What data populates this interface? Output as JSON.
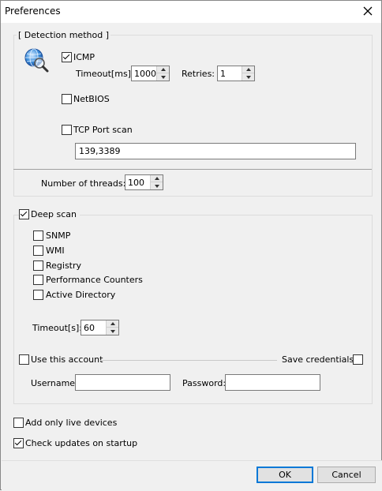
{
  "window": {
    "title": "Preferences"
  },
  "detection": {
    "legend": "[ Detection method ]",
    "icmp": {
      "label": "ICMP",
      "checked": true
    },
    "timeout_label": "Timeout[ms]:",
    "timeout_value": "1000",
    "retries_label": "Retries:",
    "retries_value": "1",
    "netbios": {
      "label": "NetBIOS",
      "checked": false
    },
    "tcp": {
      "label": "TCP Port scan",
      "checked": false
    },
    "ports_value": "139,3389"
  },
  "threads": {
    "label": "Number of threads:",
    "value": "100"
  },
  "deep_scan": {
    "label": "Deep scan",
    "checked": true,
    "items": [
      {
        "label": "SNMP",
        "checked": false
      },
      {
        "label": "WMI",
        "checked": false
      },
      {
        "label": "Registry",
        "checked": false
      },
      {
        "label": "Performance Counters",
        "checked": false
      },
      {
        "label": "Active Directory",
        "checked": false
      }
    ],
    "timeout_label": "Timeout[s]:",
    "timeout_value": "60"
  },
  "account": {
    "use_label": "Use this account",
    "use_checked": false,
    "save_label": "Save credentials",
    "save_checked": false,
    "username_label": "Username:",
    "username_value": "",
    "password_label": "Password:",
    "password_value": ""
  },
  "options": {
    "live_only": {
      "label": "Add only live devices",
      "checked": false
    },
    "check_updates": {
      "label": "Check updates on startup",
      "checked": true
    }
  },
  "buttons": {
    "ok": "OK",
    "cancel": "Cancel"
  },
  "icons": {
    "network": "globe-magnifier-icon",
    "close": "close-icon"
  }
}
